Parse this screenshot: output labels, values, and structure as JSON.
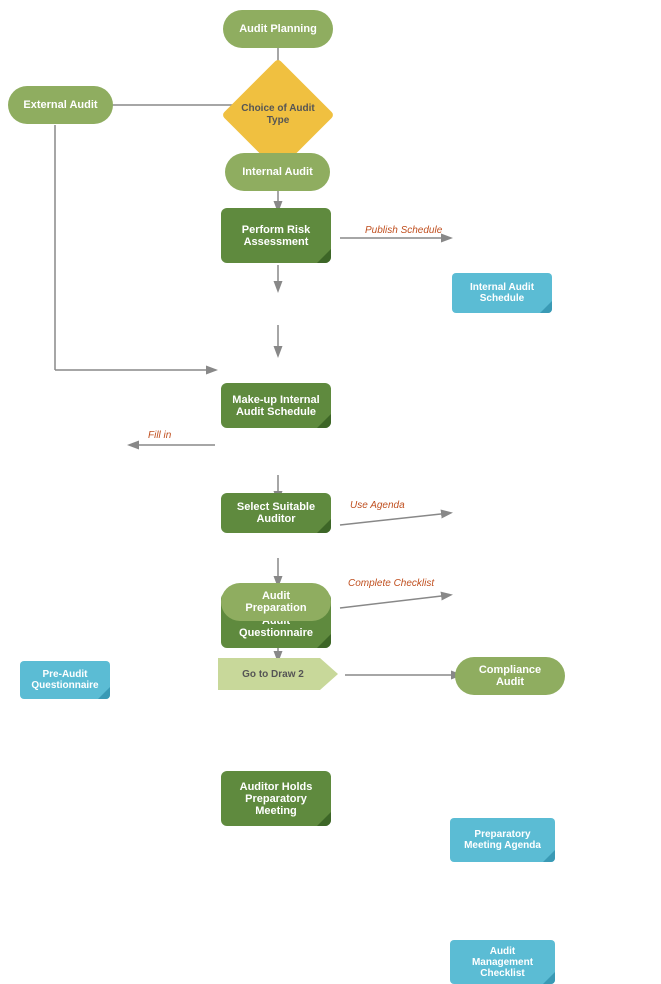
{
  "nodes": {
    "audit_planning": {
      "label": "Audit Planning"
    },
    "choice_audit_type": {
      "label": "Choice of\nAudit Type"
    },
    "external_audit": {
      "label": "External Audit"
    },
    "internal_audit": {
      "label": "Internal Audit"
    },
    "perform_risk": {
      "label": "Perform Risk\nAssessment"
    },
    "internal_audit_schedule": {
      "label": "Internal Audit\nSchedule"
    },
    "makeup_internal": {
      "label": "Make-up Internal\nAudit Schedule"
    },
    "select_suitable": {
      "label": "Select Suitable\nAuditor"
    },
    "send_off": {
      "label": "Send off\nPre-Audit\nQuestionnaire"
    },
    "pre_audit_questionnaire": {
      "label": "Pre-Audit\nQuestionnaire"
    },
    "auditor_holds": {
      "label": "Auditor Holds\nPreparatory\nMeeting"
    },
    "preparatory_meeting_agenda": {
      "label": "Preparatory\nMeeting Agenda"
    },
    "audit_preparation": {
      "label": "Audit Preparation"
    },
    "audit_management_checklist": {
      "label": "Audit Management\nChecklist"
    },
    "go_to_draw2": {
      "label": "Go to Draw 2"
    },
    "compliance_audit": {
      "label": "Compliance Audit"
    }
  },
  "edge_labels": {
    "publish_schedule": "Publish Schedule",
    "fill_in": "Fill in",
    "use_agenda": "Use Agenda",
    "complete_checklist": "Complete  Checklist"
  }
}
